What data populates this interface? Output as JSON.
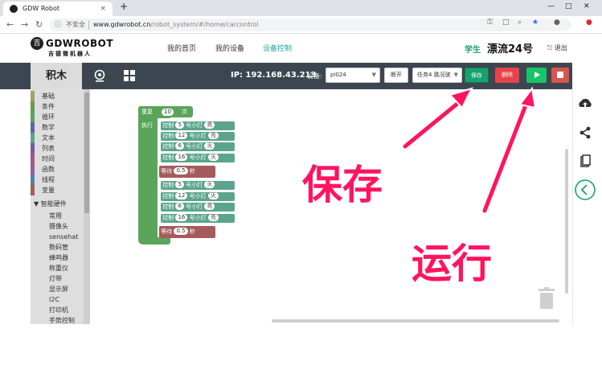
{
  "browser": {
    "tab_title": "GDW Robot",
    "tab_close": "×",
    "new_tab": "+",
    "security_label": "不安全",
    "url_host": "www.gdwrobot.cn",
    "url_path": "/robot_system/#/home/carcontrol"
  },
  "site": {
    "logo_seal": "吉",
    "logo_main": "GDWROBOT",
    "logo_sub": "吉德微机器人",
    "nav": [
      "我的首页",
      "我的设备",
      "设备控制"
    ],
    "active_nav": "设备控制",
    "user_role": "学生",
    "user_name": "漂流24号",
    "logout": "退出",
    "accent": "#18a8a0"
  },
  "toolbar": {
    "blocks_title": "积木",
    "ip": "IP: 192.168.43.213",
    "device_label": "设备:",
    "device_value": "pi024",
    "disconnect": "断开",
    "task_value": "任务4 跳况驶",
    "save": "保存",
    "delete": "删除",
    "colors": {
      "bar": "#3c4650",
      "save": "#18a26e",
      "delete": "#e9424a",
      "run": "#19c36a",
      "stop": "#d9534f"
    }
  },
  "categories": [
    {
      "label": "基础",
      "color": "#a79e6a"
    },
    {
      "label": "条件",
      "color": "#6a9a5a"
    },
    {
      "label": "循环",
      "color": "#5ba55b"
    },
    {
      "label": "数学",
      "color": "#5b67a5"
    },
    {
      "label": "文本",
      "color": "#5ba58c"
    },
    {
      "label": "列表",
      "color": "#745ba5"
    },
    {
      "label": "时间",
      "color": "#a55b80"
    },
    {
      "label": "函数",
      "color": "#995ba5"
    },
    {
      "label": "线程",
      "color": "#5b80a5"
    },
    {
      "label": "变量",
      "color": "#a55b5b"
    }
  ],
  "hardware": {
    "group": "▼ 智能硬件",
    "items": [
      "常用",
      "摄像头",
      "sensehat",
      "数码管",
      "蜂鸣器",
      "称重仪",
      "灯带",
      "显示屏",
      "I2C",
      "打印机",
      "手势控制"
    ]
  },
  "program": {
    "repeat_label": "重复",
    "repeat_count": "10",
    "repeat_unit": "次",
    "do_label": "执行",
    "control_label": "控制",
    "lamp_label": "号小灯",
    "wait_label": "等待",
    "wait_unit": "秒",
    "group1": [
      {
        "lamp": "5",
        "state": "亮"
      },
      {
        "lamp": "12",
        "state": "亮"
      },
      {
        "lamp": "6",
        "state": "灭"
      },
      {
        "lamp": "16",
        "state": "灭"
      }
    ],
    "wait1": "0.5",
    "group2": [
      {
        "lamp": "5",
        "state": "灭"
      },
      {
        "lamp": "12",
        "state": "灭"
      },
      {
        "lamp": "6",
        "state": "亮"
      },
      {
        "lamp": "16",
        "state": "亮"
      }
    ],
    "wait2": "0.5"
  },
  "annotations": {
    "save": "保存",
    "run": "运行"
  }
}
